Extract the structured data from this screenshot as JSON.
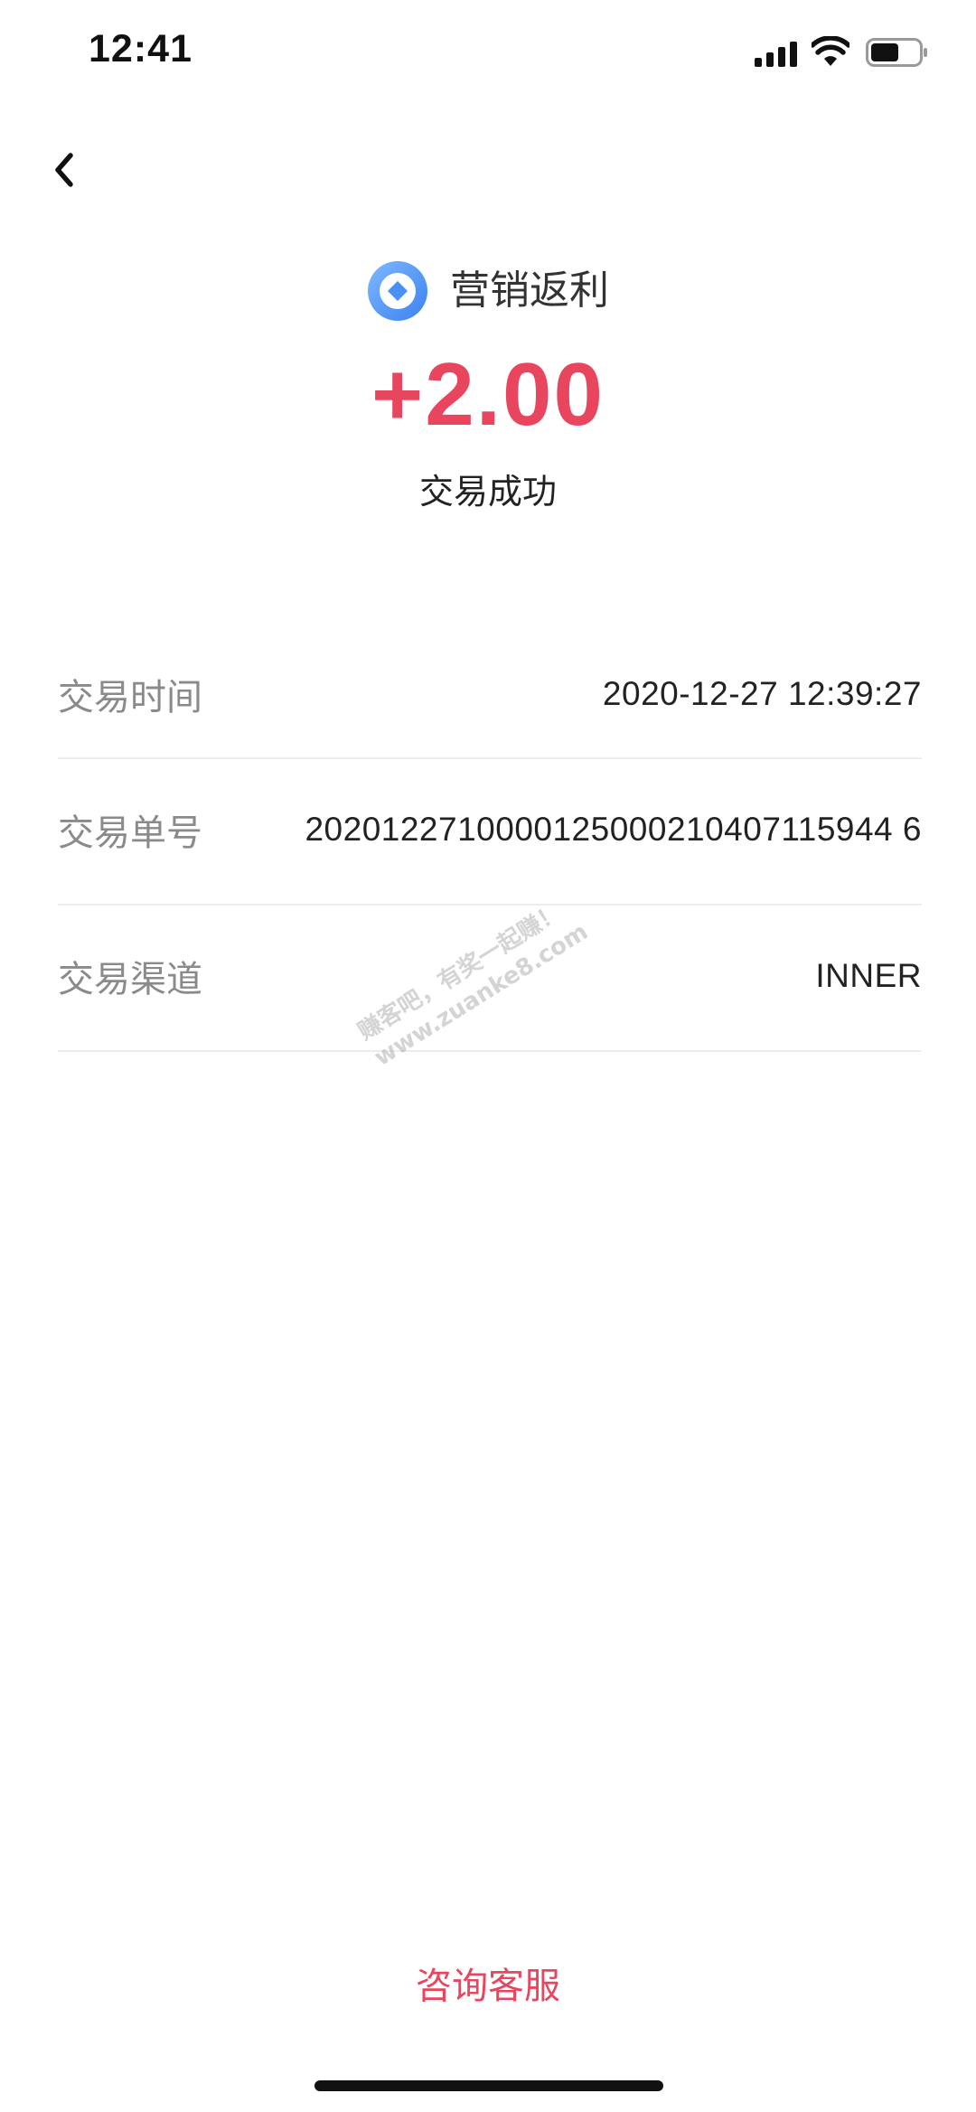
{
  "status_bar": {
    "time": "12:41"
  },
  "header": {
    "merchant_name": "营销返利",
    "amount": "+2.00",
    "status": "交易成功"
  },
  "details": [
    {
      "label": "交易时间",
      "value": "2020-12-27 12:39:27"
    },
    {
      "label": "交易单号",
      "value": "2020122710000125000210407115944 6"
    },
    {
      "label": "交易渠道",
      "value": "INNER"
    }
  ],
  "watermark": {
    "line1": "赚客吧，有奖一起赚！",
    "line2": "www.zuanke8.com"
  },
  "footer": {
    "support_label": "咨询客服"
  },
  "colors": {
    "accent": "#e8455f",
    "logo_blue": "#4a90f5",
    "label_gray": "#8a8a8a",
    "divider": "#ececec"
  },
  "icons": {
    "back": "chevron-left-icon",
    "signal": "cellular-signal-icon",
    "wifi": "wifi-icon",
    "battery": "battery-icon",
    "logo": "yuebao-coin-icon"
  }
}
